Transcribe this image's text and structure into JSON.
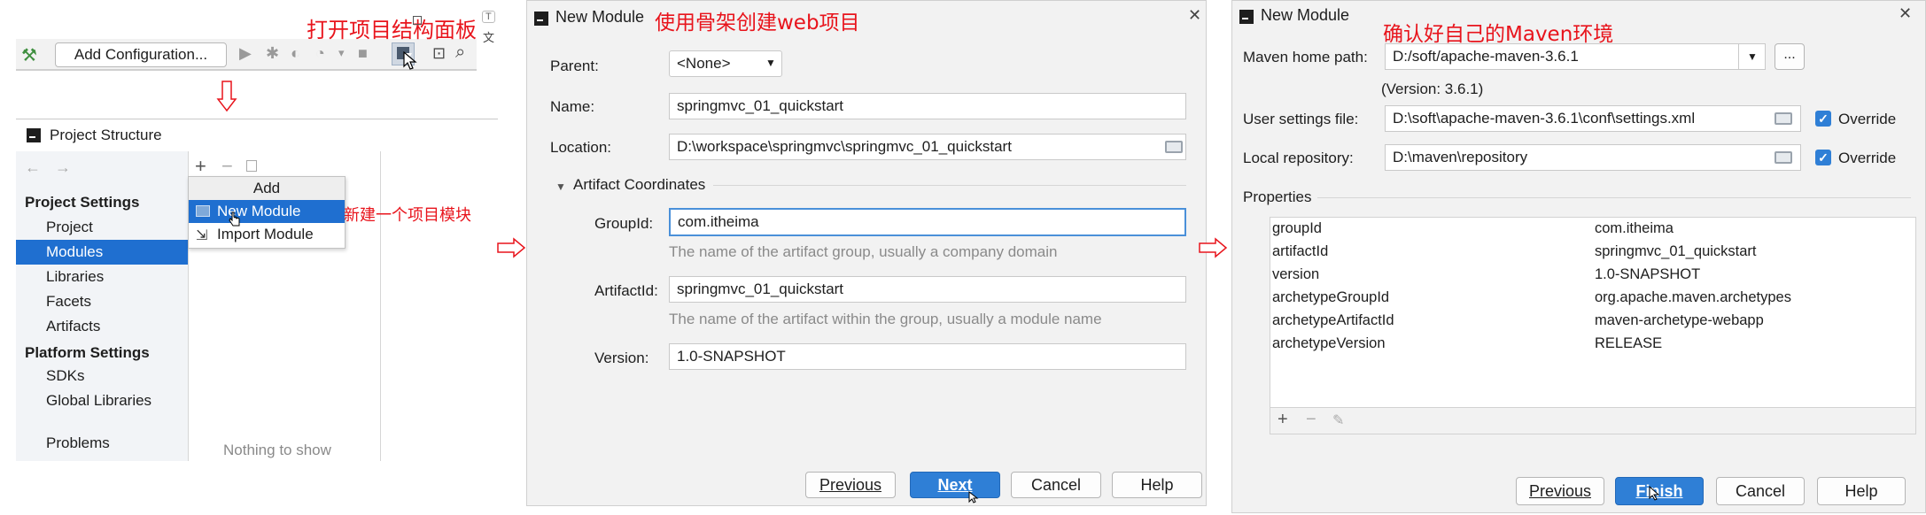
{
  "panel1": {
    "annotation": "打开项目结构面板",
    "toolbar": {
      "add_config_label": "Add Configuration..."
    },
    "sidebar_glyphs": {
      "t": "T",
      "wen": "文"
    },
    "structure_title": "Project Structure",
    "project_settings_header": "Project Settings",
    "project_settings_items": [
      "Project",
      "Modules",
      "Libraries",
      "Facets",
      "Artifacts"
    ],
    "platform_settings_header": "Platform Settings",
    "platform_settings_items": [
      "SDKs",
      "Global Libraries"
    ],
    "problems_label": "Problems",
    "popup": {
      "header": "Add",
      "new_module": "New Module",
      "import_module": "Import Module"
    },
    "new_module_annotation": "新建一个项目模块",
    "empty_text": "Nothing to show"
  },
  "panel2": {
    "title": "New Module",
    "annotation": "使用骨架创建web项目",
    "parent_label": "Parent:",
    "parent_value": "<None>",
    "name_label": "Name:",
    "name_value": "springmvc_01_quickstart",
    "location_label": "Location:",
    "location_value": "D:\\workspace\\springmvc\\springmvc_01_quickstart",
    "artifact_section": "Artifact Coordinates",
    "groupid_label": "GroupId:",
    "groupid_value": "com.itheima",
    "groupid_hint": "The name of the artifact group, usually a company domain",
    "artifactid_label": "ArtifactId:",
    "artifactid_value": "springmvc_01_quickstart",
    "artifactid_hint": "The name of the artifact within the group, usually a module name",
    "version_label": "Version:",
    "version_value": "1.0-SNAPSHOT",
    "buttons": {
      "previous": "Previous",
      "next": "Next",
      "cancel": "Cancel",
      "help": "Help"
    }
  },
  "panel3": {
    "title": "New Module",
    "annotation": "确认好自己的Maven环境",
    "maven_home_label": "Maven home path:",
    "maven_home_value": "D:/soft/apache-maven-3.6.1",
    "maven_version": "(Version: 3.6.1)",
    "user_settings_label": "User settings file:",
    "user_settings_value": "D:\\soft\\apache-maven-3.6.1\\conf\\settings.xml",
    "local_repo_label": "Local repository:",
    "local_repo_value": "D:\\maven\\repository",
    "override_label": "Override",
    "more_label": "...",
    "properties_label": "Properties",
    "properties": [
      {
        "key": "groupId",
        "value": "com.itheima"
      },
      {
        "key": "artifactId",
        "value": "springmvc_01_quickstart"
      },
      {
        "key": "version",
        "value": "1.0-SNAPSHOT"
      },
      {
        "key": "archetypeGroupId",
        "value": "org.apache.maven.archetypes"
      },
      {
        "key": "archetypeArtifactId",
        "value": "maven-archetype-webapp"
      },
      {
        "key": "archetypeVersion",
        "value": "RELEASE"
      }
    ],
    "buttons": {
      "previous": "Previous",
      "finish": "Finish",
      "cancel": "Cancel",
      "help": "Help"
    }
  },
  "colors": {
    "accent": "#2f7fd6",
    "annotation": "#e8141c",
    "selection": "#1f6fd0"
  }
}
